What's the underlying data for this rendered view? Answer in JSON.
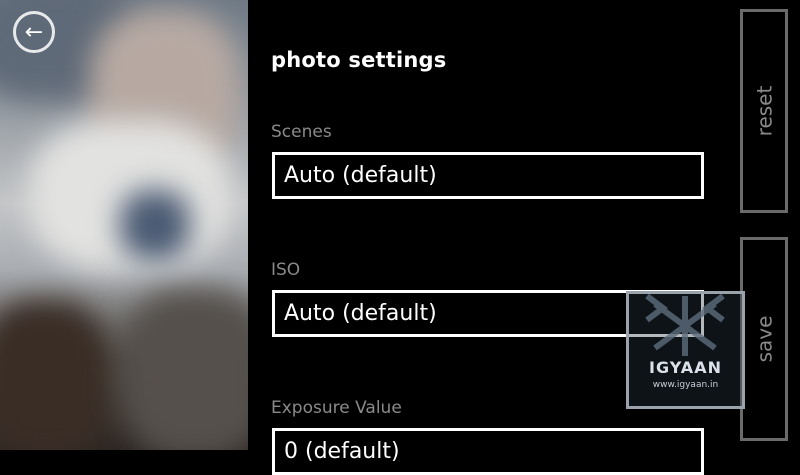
{
  "viewfinder": {
    "back_icon": "arrow-left-icon"
  },
  "page": {
    "title": "photo settings"
  },
  "settings": [
    {
      "label": "Scenes",
      "value": "Auto (default)"
    },
    {
      "label": "ISO",
      "value": "Auto (default)"
    },
    {
      "label": "Exposure Value",
      "value": "0 (default)"
    }
  ],
  "app_bar": {
    "reset_label": "reset",
    "save_label": "save"
  },
  "watermark": {
    "brand": "IGYAAN",
    "url": "www.igyaan.in"
  },
  "colors": {
    "background": "#000000",
    "label": "#8a8a8a",
    "text": "#ffffff",
    "button_border": "#6a6a6a"
  }
}
